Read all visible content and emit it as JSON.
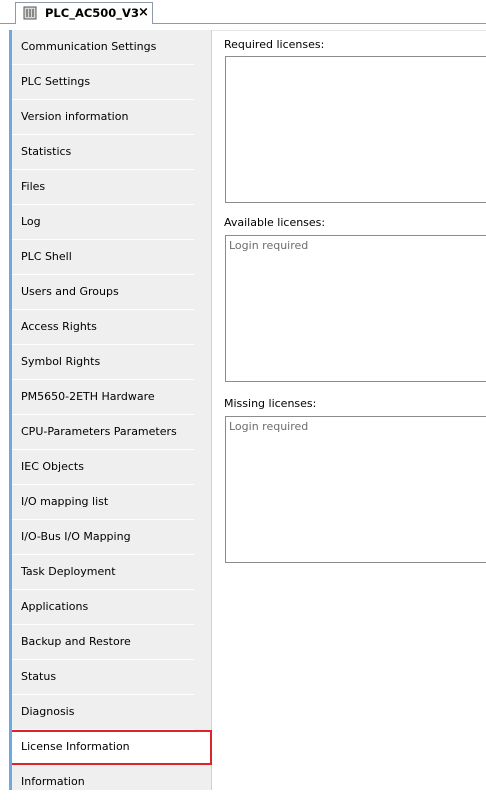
{
  "tab": {
    "title": "PLC_AC500_V3",
    "close_icon": "×"
  },
  "sidebar": {
    "items": [
      {
        "label": "Communication Settings"
      },
      {
        "label": "PLC Settings"
      },
      {
        "label": "Version  information"
      },
      {
        "label": "Statistics"
      },
      {
        "label": "Files"
      },
      {
        "label": "Log"
      },
      {
        "label": "PLC Shell"
      },
      {
        "label": "Users and Groups"
      },
      {
        "label": "Access Rights"
      },
      {
        "label": "Symbol Rights"
      },
      {
        "label": "PM5650-2ETH Hardware"
      },
      {
        "label": "CPU-Parameters Parameters"
      },
      {
        "label": "IEC Objects"
      },
      {
        "label": "I/O mapping list"
      },
      {
        "label": "I/O-Bus I/O Mapping"
      },
      {
        "label": "Task Deployment"
      },
      {
        "label": "Applications"
      },
      {
        "label": "Backup and Restore"
      },
      {
        "label": "Status"
      },
      {
        "label": "Diagnosis"
      },
      {
        "label": "License Information",
        "selected": true
      },
      {
        "label": "Information"
      }
    ],
    "selected_color": "#d9262c"
  },
  "main": {
    "required": {
      "label": "Required licenses:",
      "content": ""
    },
    "available": {
      "label": "Available licenses:",
      "content": "Login required"
    },
    "missing": {
      "label": "Missing licenses:",
      "content": "Login required"
    }
  }
}
